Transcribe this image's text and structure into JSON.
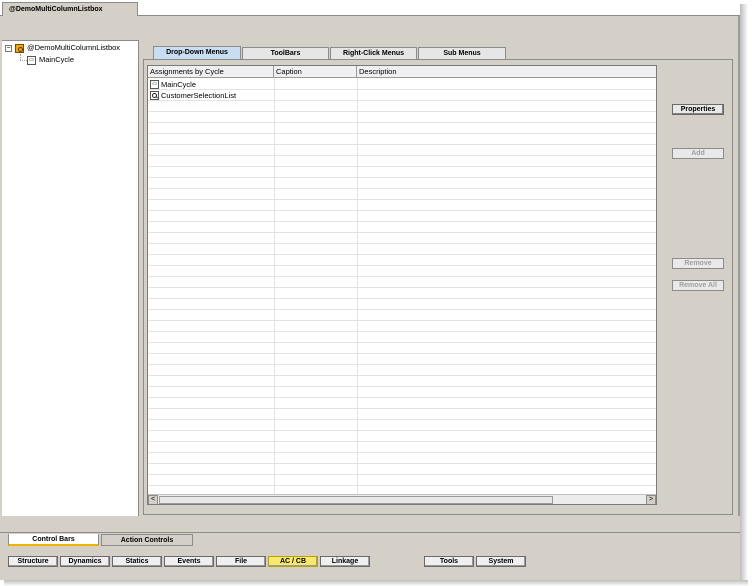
{
  "document_tab": {
    "label": "@DemoMultiColumnListbox"
  },
  "tree": {
    "expander": "−",
    "root": {
      "label": "@DemoMultiColumnListbox",
      "icon": "cycle-root-icon"
    },
    "child": {
      "label": "MainCycle",
      "icon": "cycle-icon"
    }
  },
  "tabs": [
    {
      "label": "Drop-Down Menus",
      "active": true
    },
    {
      "label": "ToolBars",
      "active": false
    },
    {
      "label": "Right-Click Menus",
      "active": false
    },
    {
      "label": "Sub Menus",
      "active": false
    }
  ],
  "grid": {
    "columns": [
      "Assignments by Cycle",
      "Caption",
      "Description"
    ],
    "rows": [
      {
        "assignment": "MainCycle",
        "caption": "",
        "description": "",
        "icon": "cycle-icon"
      },
      {
        "assignment": "CustomerSelectionList",
        "caption": "",
        "description": "",
        "icon": "search-list-icon"
      }
    ],
    "scroll_left": "<",
    "scroll_right": ">"
  },
  "side_buttons": {
    "properties": "Properties",
    "add": "Add",
    "remove": "Remove",
    "remove_all": "Remove All"
  },
  "control_tabs": [
    {
      "label": "Control Bars",
      "active": true
    },
    {
      "label": "Action Controls",
      "active": false
    }
  ],
  "nav_buttons": [
    {
      "label": "Structure",
      "active": false
    },
    {
      "label": "Dynamics",
      "active": false
    },
    {
      "label": "Statics",
      "active": false
    },
    {
      "label": "Events",
      "active": false
    },
    {
      "label": "File",
      "active": false
    },
    {
      "label": "AC / CB",
      "active": true
    },
    {
      "label": "Linkage",
      "active": false
    },
    {
      "label": "Tools",
      "active": false
    },
    {
      "label": "System",
      "active": false
    }
  ],
  "colors": {
    "active_tab": "#c9ddf2",
    "active_nav": "#f6e96b",
    "active_ctrl_underline": "#f0b400",
    "window_bg": "#d4d0c8"
  }
}
